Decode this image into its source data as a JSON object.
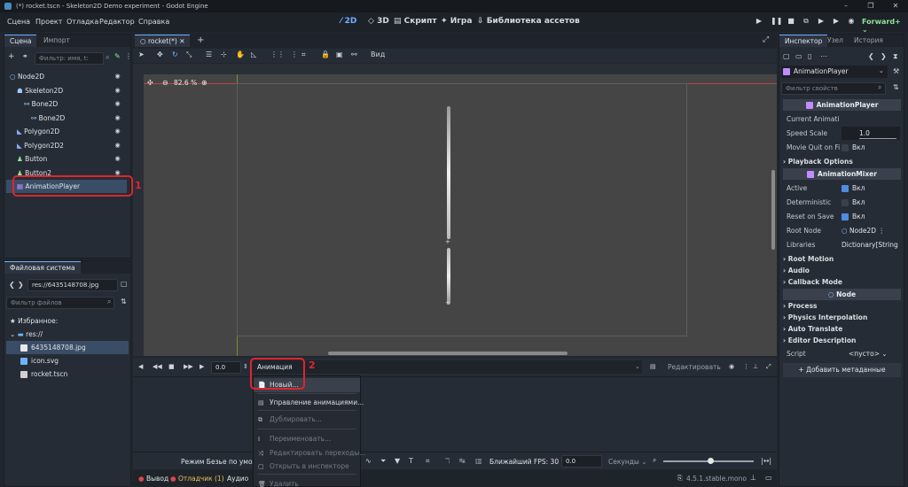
{
  "window": {
    "title": "(*) rocket.tscn - Skeleton2D Demo experiment - Godot Engine",
    "controls": [
      "–",
      "❐",
      "✕"
    ]
  },
  "menu": [
    "Сцена",
    "Проект",
    "Отладка",
    "Редактор",
    "Справка"
  ],
  "modes": [
    "2D",
    "3D",
    "Скрипт",
    "Игра",
    "Библиотека ассетов"
  ],
  "renderer": "Forward+",
  "scene_panel": {
    "tabs": [
      "Сцена",
      "Импорт"
    ],
    "filter_placeholder": "Фильтр: имя, t:",
    "nodes": [
      {
        "label": "Node2D",
        "color": "#9ecbff",
        "depth": 0
      },
      {
        "label": "Skeleton2D",
        "color": "#9ecbff",
        "depth": 1
      },
      {
        "label": "Bone2D",
        "color": "#9ecbff",
        "depth": 2
      },
      {
        "label": "Bone2D",
        "color": "#9ecbff",
        "depth": 3
      },
      {
        "label": "Polygon2D",
        "color": "#8aa9ff",
        "depth": 1
      },
      {
        "label": "Polygon2D2",
        "color": "#8aa9ff",
        "depth": 1
      },
      {
        "label": "Button",
        "color": "#8eef97",
        "depth": 1
      },
      {
        "label": "Button2",
        "color": "#8eef97",
        "depth": 1
      },
      {
        "label": "AnimationPlayer",
        "color": "#c28cff",
        "depth": 1
      }
    ]
  },
  "filesystem": {
    "title": "Файловая система",
    "path": "res://6435148708.jpg",
    "filter_placeholder": "Фильтр файлов",
    "favorites": "Избранное:",
    "root": "res://",
    "files": [
      "6435148708.jpg",
      "icon.svg",
      "rocket.tscn"
    ]
  },
  "editor_tab": "rocket(*)",
  "toolbar": {
    "view": "Вид",
    "zoom": "82.6 %"
  },
  "animation": {
    "time": "0.0",
    "anim_button": "Анимация",
    "edit": "Редактировать",
    "bezier_mode": "Режим Безье по умолч",
    "fps": "Ближайший FPS: 30",
    "step": "0.0",
    "unit": "Секунды"
  },
  "popup": [
    {
      "label": "Новый...",
      "enabled": true,
      "icon": "📄"
    },
    {
      "label": "Управление анимациями...",
      "enabled": true,
      "icon": "▤"
    },
    {
      "label": "Дублировать...",
      "enabled": false,
      "icon": "⧉"
    },
    {
      "label": "Переименовать...",
      "enabled": false,
      "icon": "I"
    },
    {
      "label": "Редактировать переходы...",
      "enabled": false,
      "icon": "⤨"
    },
    {
      "label": "Открыть в инспекторе",
      "enabled": false,
      "icon": "▢"
    },
    {
      "label": "Удалить",
      "enabled": false,
      "icon": "🗑"
    }
  ],
  "bottom_tabs": [
    "Вывод",
    "Отладчик (1)",
    "Аудио"
  ],
  "version": "4.5.1.stable.mono",
  "inspector": {
    "tabs": [
      "Инспектор",
      "Узел",
      "История"
    ],
    "object": "AnimationPlayer",
    "filter_placeholder": "Фильтр свойств",
    "header1": "AnimationPlayer",
    "current_anim": "Current Animati",
    "speed_scale_label": "Speed Scale",
    "speed_scale": "1.0",
    "movie_quit_label": "Movie Quit on Fi",
    "on": "Вкл",
    "playback": "Playback Options",
    "header2": "AnimationMixer",
    "active_label": "Active",
    "deterministic_label": "Deterministic",
    "reset_label": "Reset on Save",
    "root_node_label": "Root Node",
    "root_node": "Node2D",
    "libraries_label": "Libraries",
    "libraries": "Dictionary[String",
    "sections1": [
      "Root Motion",
      "Audio",
      "Callback Mode"
    ],
    "header3": "Node",
    "sections2": [
      "Process",
      "Physics Interpolation",
      "Auto Translate",
      "Editor Description"
    ],
    "script_label": "Script",
    "script_value": "<пусто>",
    "add_meta": "Добавить метаданные"
  },
  "annotations": [
    "1",
    "2"
  ],
  "colors": {
    "accent": "#6fb3ff",
    "highlight": "#e0242d"
  }
}
